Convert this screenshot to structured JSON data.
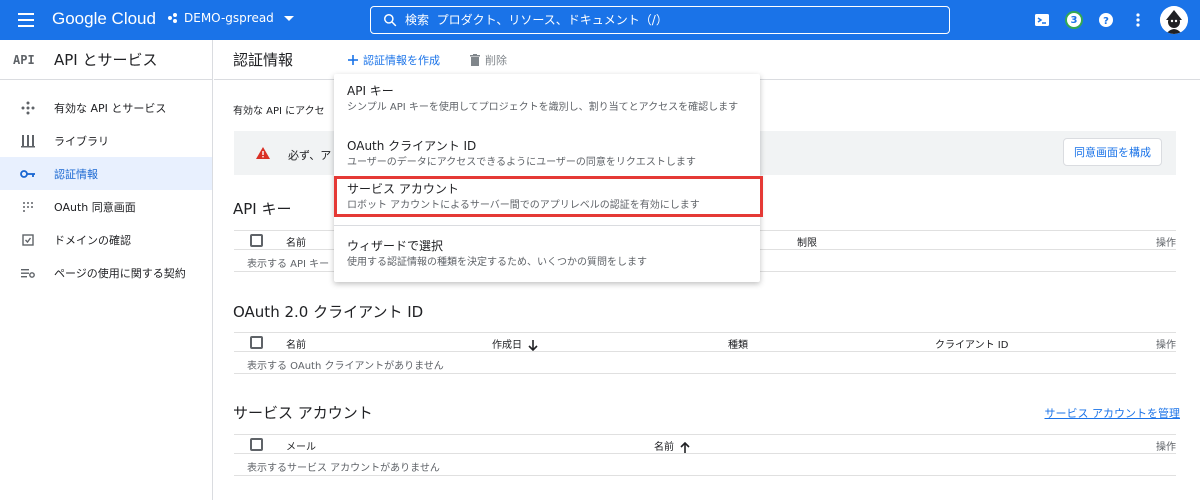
{
  "header": {
    "brand": "Google Cloud",
    "project": "DEMO-gspread",
    "search_placeholder": "検索  プロダクト、リソース、ドキュメント（/）",
    "notification_count": "3",
    "brand_color": "#1a73e8"
  },
  "sidebar": {
    "logo": "API",
    "title": "API とサービス",
    "items": [
      {
        "label": "有効な API とサービス",
        "icon": "hub-icon"
      },
      {
        "label": "ライブラリ",
        "icon": "library-icon"
      },
      {
        "label": "認証情報",
        "icon": "key-icon",
        "active": true
      },
      {
        "label": "OAuth 同意画面",
        "icon": "consent-icon"
      },
      {
        "label": "ドメインの確認",
        "icon": "checkbox-icon"
      },
      {
        "label": "ページの使用に関する契約",
        "icon": "settings-list-icon"
      }
    ]
  },
  "main": {
    "title": "認証情報",
    "create_label": "認証情報を作成",
    "delete_label": "削除",
    "info_text": "有効な API にアクセ",
    "warning_text": "必ず、ア",
    "consent_button": "同意画面を構成"
  },
  "menu": {
    "items": [
      {
        "title": "API キー",
        "desc": "シンプル API キーを使用してプロジェクトを識別し、割り当てとアクセスを確認します"
      },
      {
        "title": "OAuth クライアント ID",
        "desc": "ユーザーのデータにアクセスできるようにユーザーの同意をリクエストします"
      },
      {
        "title": "サービス アカウント",
        "desc": "ロボット アカウントによるサーバー間でのアプリレベルの認証を有効にします"
      },
      {
        "title": "ウィザードで選択",
        "desc": "使用する認証情報の種類を決定するため、いくつかの質問をします"
      }
    ]
  },
  "api_keys": {
    "title": "API キー",
    "col_name": "名前",
    "col_restriction": "制限",
    "col_ops": "操作",
    "empty": "表示する API キー"
  },
  "oauth": {
    "title": "OAuth 2.0 クライアント ID",
    "col_name": "名前",
    "col_created": "作成日",
    "col_type": "種類",
    "col_client": "クライアント ID",
    "col_ops": "操作",
    "empty": "表示する OAuth クライアントがありません"
  },
  "service_accounts": {
    "title": "サービス アカウント",
    "manage_link": "サービス アカウントを管理",
    "col_email": "メール",
    "col_name": "名前",
    "col_ops": "操作",
    "empty": "表示するサービス アカウントがありません"
  }
}
